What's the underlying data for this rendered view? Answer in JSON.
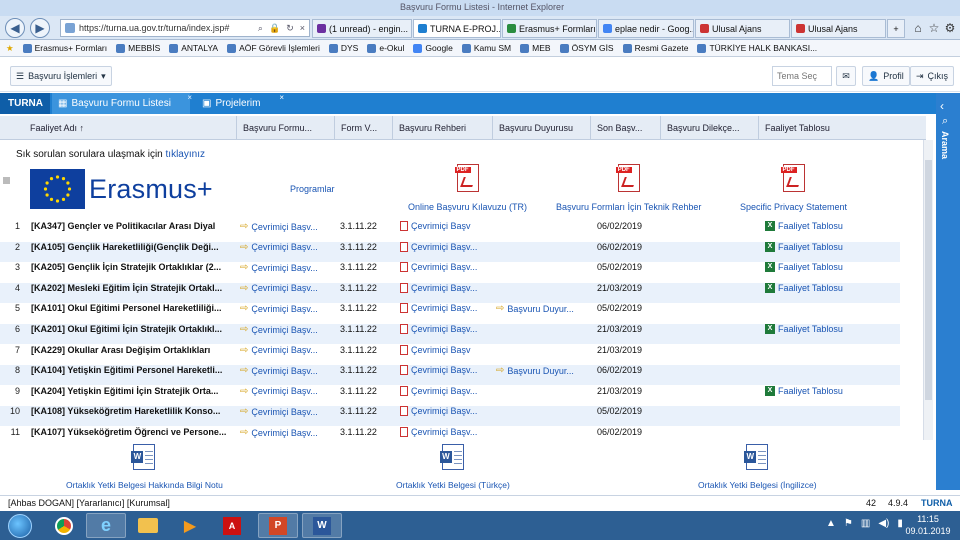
{
  "browser": {
    "window_title": "Başvuru Formu Listesi - Internet Explorer",
    "address": "https://turna.ua.gov.tr/turna/index.jsp#",
    "tabs": [
      {
        "label": "(1 unread) - engin...",
        "color": "#6b2fa0",
        "active": false
      },
      {
        "label": "TURNA E-PROJ...",
        "color": "#1f7fd0",
        "active": true
      },
      {
        "label": "Erasmus+ Formları...",
        "color": "#2a8c3f",
        "active": false
      },
      {
        "label": "eplae nedir - Goog...",
        "color": "#4285f4",
        "active": false
      },
      {
        "label": "Ulusal Ajans",
        "color": "#c33",
        "active": false
      },
      {
        "label": "Ulusal Ajans",
        "color": "#c33",
        "active": false
      }
    ],
    "favorites": [
      "Erasmus+ Formları",
      "MEBBİS",
      "ANTALYA",
      "AÖF Görevli İşlemleri",
      "DYS",
      "e-Okul",
      "Google",
      "Kamu SM",
      "MEB",
      "ÖSYM GİS",
      "Resmi Gazete",
      "TÜRKİYE HALK BANKASI..."
    ]
  },
  "header": {
    "ops_label": "Başvuru İşlemleri",
    "search_placeholder": "Tema Seç",
    "profile_label": "Profil",
    "logout_label": "Çıkış"
  },
  "apptabs": {
    "brand": "TURNA",
    "tab1": "Başvuru Formu Listesi",
    "tab2": "Projelerim",
    "side_label": "Arama"
  },
  "columns": [
    "Faaliyet Adı ↑",
    "Başvuru Formu...",
    "Form V...",
    "Başvuru Rehberi",
    "Başvuru Duyurusu",
    "Son Başv...",
    "Başvuru Dilekçe...",
    "Faaliyet Tablosu"
  ],
  "faq": {
    "text": "Sık sorulan sorulara ulaşmak için ",
    "link": "tıklayınız"
  },
  "logo_text": "Erasmus+",
  "programlar": "Programlar",
  "pdfs": [
    "Online Başvuru Kılavuzu (TR)",
    "Başvuru Formları İçin Teknik Rehber",
    "Specific Privacy Statement"
  ],
  "rows": [
    {
      "n": "1",
      "title": "[KA347] Gençler ve Politikacılar Arası Diyal",
      "form": "Çevrimiçi Başv...",
      "ver": "3.1.11.22",
      "guide": "Çevrimiçi Başv",
      "notice": "",
      "date": "06/02/2019",
      "table": "Faaliyet Tablosu"
    },
    {
      "n": "2",
      "title": "[KA105] Gençlik Hareketliliği(Gençlik Deği...",
      "form": "Çevrimiçi Başv...",
      "ver": "3.1.11.22",
      "guide": "Çevrimiçi Başv...",
      "notice": "",
      "date": "06/02/2019",
      "table": "Faaliyet Tablosu"
    },
    {
      "n": "3",
      "title": "[KA205] Gençlik İçin Stratejik Ortaklıklar (2...",
      "form": "Çevrimiçi Başv...",
      "ver": "3.1.11.22",
      "guide": "Çevrimiçi Başv...",
      "notice": "",
      "date": "05/02/2019",
      "table": "Faaliyet Tablosu"
    },
    {
      "n": "4",
      "title": "[KA202] Mesleki Eğitim İçin Stratejik Ortakl...",
      "form": "Çevrimiçi Başv...",
      "ver": "3.1.11.22",
      "guide": "Çevrimiçi Başv...",
      "notice": "",
      "date": "21/03/2019",
      "table": "Faaliyet Tablosu"
    },
    {
      "n": "5",
      "title": "[KA101] Okul Eğitimi Personel Hareketliliği...",
      "form": "Çevrimiçi Başv...",
      "ver": "3.1.11.22",
      "guide": "Çevrimiçi Başv...",
      "notice": "Başvuru Duyur...",
      "date": "05/02/2019",
      "table": ""
    },
    {
      "n": "6",
      "title": "[KA201] Okul Eğitimi İçin Stratejik Ortaklıkl...",
      "form": "Çevrimiçi Başv...",
      "ver": "3.1.11.22",
      "guide": "Çevrimiçi Başv...",
      "notice": "",
      "date": "21/03/2019",
      "table": "Faaliyet Tablosu"
    },
    {
      "n": "7",
      "title": "[KA229] Okullar Arası Değişim Ortaklıkları",
      "form": "Çevrimiçi Başv...",
      "ver": "3.1.11.22",
      "guide": "Çevrimiçi Başv",
      "notice": "",
      "date": "21/03/2019",
      "table": ""
    },
    {
      "n": "8",
      "title": "[KA104] Yetişkin Eğitimi Personel Hareketli...",
      "form": "Çevrimiçi Başv...",
      "ver": "3.1.11.22",
      "guide": "Çevrimiçi Başv...",
      "notice": "Başvuru Duyur...",
      "date": "06/02/2019",
      "table": ""
    },
    {
      "n": "9",
      "title": "[KA204] Yetişkin Eğitimi İçin Stratejik Orta...",
      "form": "Çevrimiçi Başv...",
      "ver": "3.1.11.22",
      "guide": "Çevrimiçi Başv...",
      "notice": "",
      "date": "21/03/2019",
      "table": "Faaliyet Tablosu"
    },
    {
      "n": "10",
      "title": "[KA108] Yükseköğretim Hareketlilik Konso...",
      "form": "Çevrimiçi Başv...",
      "ver": "3.1.11.22",
      "guide": "Çevrimiçi Başv...",
      "notice": "",
      "date": "05/02/2019",
      "table": ""
    },
    {
      "n": "11",
      "title": "[KA107] Yükseköğretim Öğrenci ve Persone...",
      "form": "Çevrimiçi Başv...",
      "ver": "3.1.11.22",
      "guide": "Çevrimiçi Başv...",
      "notice": "",
      "date": "06/02/2019",
      "table": ""
    }
  ],
  "docs": [
    "Ortaklık Yetki Belgesi Hakkında Bilgi Notu",
    "Ortaklık Yetki Belgesi (Türkçe)",
    "Ortaklık Yetki Belgesi (İngilizce)"
  ],
  "status": {
    "user": "[Ahbas DOGAN] [Yararlanıcı] [Kurumsal]",
    "count": "42",
    "version": "4.9.4",
    "brand": "TURNA"
  },
  "clock": {
    "time": "11:15",
    "date": "09.01.2019"
  },
  "colors": {
    "brand_blue": "#1f7fd0",
    "link": "#1a55b3",
    "alt_row": "#e9f1fb",
    "taskbar": "#2d5f93"
  }
}
